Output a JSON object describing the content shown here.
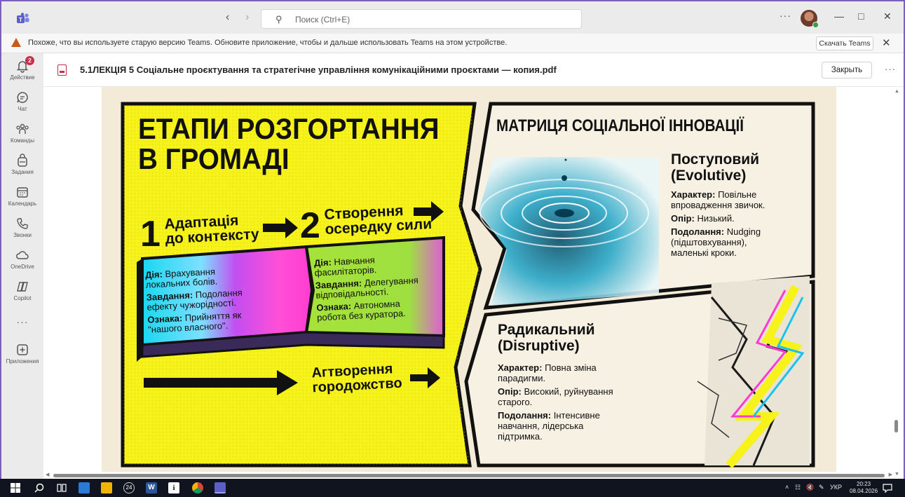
{
  "titlebar": {
    "search_placeholder": "Поиск (Ctrl+E)",
    "more": "···"
  },
  "banner": {
    "message": "Похоже, что вы используете старую версию Teams. Обновите приложение, чтобы и дальше использовать Teams на этом устройстве.",
    "download_label": "Скачать Teams"
  },
  "rail": {
    "items": [
      {
        "label": "Действие",
        "badge": "2"
      },
      {
        "label": "Чат"
      },
      {
        "label": "Команды"
      },
      {
        "label": "Задания"
      },
      {
        "label": "Календарь"
      },
      {
        "label": "Звонки"
      },
      {
        "label": "OneDrive"
      },
      {
        "label": "Copilot"
      },
      {
        "label": "Приложения"
      }
    ],
    "more": "···"
  },
  "document": {
    "title": "5.1ЛЕКЦІЯ 5 Соціальне проєктування та стратегічне управління комунікаційними проєктами — копия.pdf",
    "close_label": "Закрыть",
    "more": "···"
  },
  "slide": {
    "left_title_1": "ЕТАПИ РОЗГОРТАННЯ",
    "left_title_2": "В ГРОМАДІ",
    "step1_num": "1",
    "step1_label_1": "Адаптація",
    "step1_label_2": "до контексту",
    "step2_num": "2",
    "step2_label_1": "Створення",
    "step2_label_2": "осередку сили",
    "box1_action_key": "Дія:",
    "box1_action_1": "Врахування",
    "box1_action_2": "локальних болів.",
    "box1_task_key": "Завдання:",
    "box1_task_1": "Подолання",
    "box1_task_2": "ефекту чужорідності.",
    "box1_sign_key": "Ознака:",
    "box1_sign_1": "Прийняття як",
    "box1_sign_2": "\"нашого власного\".",
    "box2_action_key": "Дія:",
    "box2_action_1": "Навчання",
    "box2_action_2": "фасилітаторів.",
    "box2_task_key": "Завдання:",
    "box2_task_1": "Делегування",
    "box2_task_2": "відповідальності.",
    "box2_sign_key": "Ознака:",
    "box2_sign_1": "Автономна",
    "box2_sign_2": "робота без куратора.",
    "bottom_label_1": "Агтворення",
    "bottom_label_2": "городожство",
    "right_title": "МАТРИЦЯ СОЦІАЛЬНОЇ ІННОВАЦІЇ",
    "evo_title_1": "Поступовий",
    "evo_title_2": "(Evolutive)",
    "evo_char_key": "Характер:",
    "evo_char_1": "Повільне",
    "evo_char_2": "впровадження звичок.",
    "evo_res_key": "Опір:",
    "evo_res": "Низький.",
    "evo_over_key": "Подолання:",
    "evo_over_1": "Nudging",
    "evo_over_2": "(підштовхування),",
    "evo_over_3": "маленькі кроки.",
    "dis_title_1": "Радикальний",
    "dis_title_2": "(Disruptive)",
    "dis_char_key": "Характер:",
    "dis_char_1": "Повна зміна",
    "dis_char_2": "парадигми.",
    "dis_res_key": "Опір:",
    "dis_res_1": "Високий, руйнування",
    "dis_res_2": "старого.",
    "dis_over_key": "Подолання:",
    "dis_over_1": "Інтенсивне",
    "dis_over_2": "навчання, лідерська",
    "dis_over_3": "підтримка."
  },
  "taskbar": {
    "weather_badge": "24",
    "language": "УКР",
    "time": "20:23",
    "date": "08.04.2026"
  },
  "colors": {
    "frame": "#7b5fb8",
    "yellow": "#f6f21a",
    "teams_purple": "#5b5fc7",
    "badge_red": "#c4314b"
  }
}
